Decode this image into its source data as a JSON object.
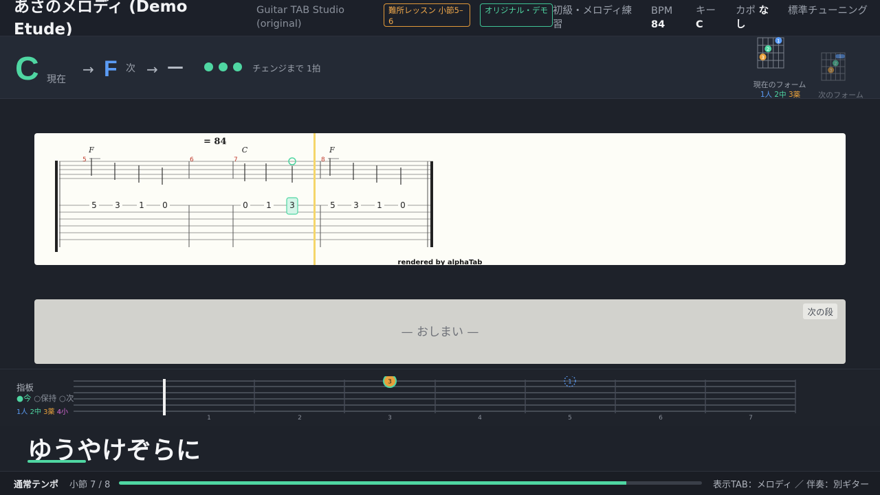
{
  "header": {
    "song_title": "あさのメロディ (Demo Etude)",
    "app_name": "Guitar TAB Studio (original)",
    "badge_lesson": "難所レッスン 小節5–6",
    "badge_origin": "オリジナル・デモ",
    "level": "初級・メロディ練習",
    "bpm_label": "BPM",
    "bpm_value": "84",
    "key_label": "キー",
    "key_value": "C",
    "capo_label": "カポ",
    "capo_value": "なし",
    "tuning": "標準チューニング"
  },
  "chord_strip": {
    "current_chord": "C",
    "current_label": "現在",
    "arrow": "→",
    "next_chord": "F",
    "next_label": "次",
    "after_next": "—",
    "beats_dots": 3,
    "countdown_text": "チェンジまで 1拍",
    "current_form_caption": "現在のフォーム",
    "finger_legend": [
      "1人",
      "2中",
      "3薬"
    ],
    "next_form_caption": "次のフォーム",
    "current_form_fingers": [
      "1",
      "2",
      "3"
    ],
    "next_form_fingers": [
      "1",
      "2",
      "3"
    ]
  },
  "score": {
    "tempo_text": "= 84",
    "credit": "rendered by alphaTab",
    "chord_names": [
      "F",
      "C",
      "F"
    ],
    "bar_numbers": [
      "5",
      "6",
      "7",
      "8"
    ],
    "tab_notes": [
      "5",
      "3",
      "1",
      "0",
      "0",
      "1",
      "3",
      "5",
      "3",
      "1",
      "0"
    ]
  },
  "next_panel": {
    "button": "次の段",
    "end_text": "— おしまい —"
  },
  "fretboard": {
    "title": "指板",
    "legend_now": "●今",
    "legend_hold": "○保持",
    "legend_next": "○次",
    "finger_legend": [
      "1人",
      "2中",
      "3薬",
      "4小"
    ],
    "fret_numbers": [
      "1",
      "2",
      "3",
      "4",
      "5",
      "6",
      "7"
    ],
    "marker_now": "3",
    "marker_next": "1",
    "colors": {
      "accent": "#4fd6a2",
      "next": "#5b9cf5",
      "finger3": "#e8a13c",
      "finger4": "#d86ad8"
    }
  },
  "lyrics": {
    "line": "ゆうやけぞらに"
  },
  "status": {
    "tempo_mode": "通常テンポ",
    "measure": "小節 7 / 8",
    "progress": 0.87,
    "tab_info": "表示TAB：メロディ ／ 伴奏：別ギター"
  }
}
